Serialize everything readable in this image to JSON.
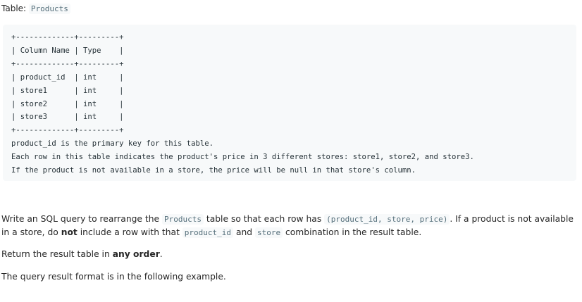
{
  "table_label": {
    "prefix": "Table:",
    "name": "Products"
  },
  "schema_block": {
    "lines": [
      "+-------------+---------+",
      "| Column Name | Type    |",
      "+-------------+---------+",
      "| product_id  | int     |",
      "| store1      | int     |",
      "| store2      | int     |",
      "| store3      | int     |",
      "+-------------+---------+",
      "product_id is the primary key for this table.",
      "Each row in this table indicates the product's price in 3 different stores: store1, store2, and store3.",
      "If the product is not available in a store, the price will be null in that store's column."
    ]
  },
  "paragraph1": {
    "t1": "Write an SQL query to rearrange the ",
    "code1": "Products",
    "t2": " table so that each row has ",
    "code2": "(product_id, store, price)",
    "t3": ". If a product is not available in a store, do ",
    "bold1": "not",
    "t4": " include a row with that ",
    "code3": "product_id",
    "t5": " and ",
    "code4": "store",
    "t6": " combination in the result table."
  },
  "paragraph2": {
    "t1": "Return the result table in ",
    "bold1": "any order",
    "t2": "."
  },
  "paragraph3": {
    "text": "The query result format is in the following example."
  }
}
